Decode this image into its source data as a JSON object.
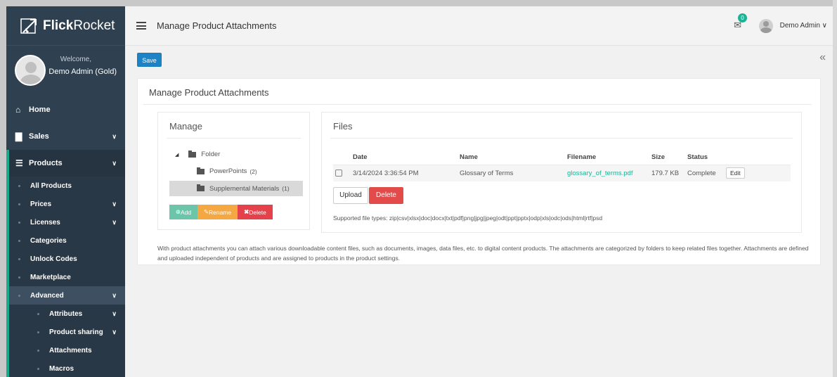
{
  "brand": {
    "name_bold": "Flick",
    "name_rest": "Rocket"
  },
  "welcome": {
    "greeting": "Welcome,",
    "user": "Demo Admin (Gold)"
  },
  "sidebar": {
    "items": [
      {
        "label": "Home",
        "icon": "home-icon"
      },
      {
        "label": "Sales",
        "icon": "bar-chart-icon"
      },
      {
        "label": "Products",
        "icon": "list-icon"
      }
    ],
    "products_sub": [
      {
        "label": "All Products"
      },
      {
        "label": "Prices"
      },
      {
        "label": "Licenses"
      },
      {
        "label": "Categories"
      },
      {
        "label": "Unlock Codes"
      },
      {
        "label": "Marketplace"
      },
      {
        "label": "Advanced"
      },
      {
        "label": "Attributes"
      },
      {
        "label": "Product sharing"
      },
      {
        "label": "Attachments"
      },
      {
        "label": "Macros"
      }
    ]
  },
  "topbar": {
    "title": "Manage Product Attachments",
    "badge": "0",
    "user": "Demo Admin"
  },
  "toolbar": {
    "save_label": "Save"
  },
  "card": {
    "title": "Manage Product Attachments"
  },
  "manage": {
    "title": "Manage",
    "root": "Folder",
    "folders": [
      {
        "name": "PowerPoints",
        "count": "(2)"
      },
      {
        "name": "Supplemental Materials",
        "count": "(1)"
      }
    ],
    "add_label": "Add",
    "rename_label": "Rename",
    "delete_label": "Delete"
  },
  "files": {
    "title": "Files",
    "columns": [
      "Date",
      "Name",
      "Filename",
      "Size",
      "Status"
    ],
    "rows": [
      {
        "date": "3/14/2024 3:36:54 PM",
        "name": "Glossary of Terms",
        "filename": "glossary_of_terms.pdf",
        "size": "179.7 KB",
        "status": "Complete",
        "edit": "Edit"
      }
    ],
    "upload_label": "Upload",
    "delete_label": "Delete",
    "supported": "Supported file types: zip|csv|xlsx|doc|docx|txt|pdf|png|jpg|jpeg|odt|ppt|pptx|odp|xls|odc|ods|html|rtf|psd"
  },
  "description": "With product attachments you can attach various downloadable content files, such as documents, images, data files, etc. to digital content products. The attachments are categorized by folders to keep related files together. Attachments are defined and uploaded independent of products and are assigned to products in the product settings."
}
